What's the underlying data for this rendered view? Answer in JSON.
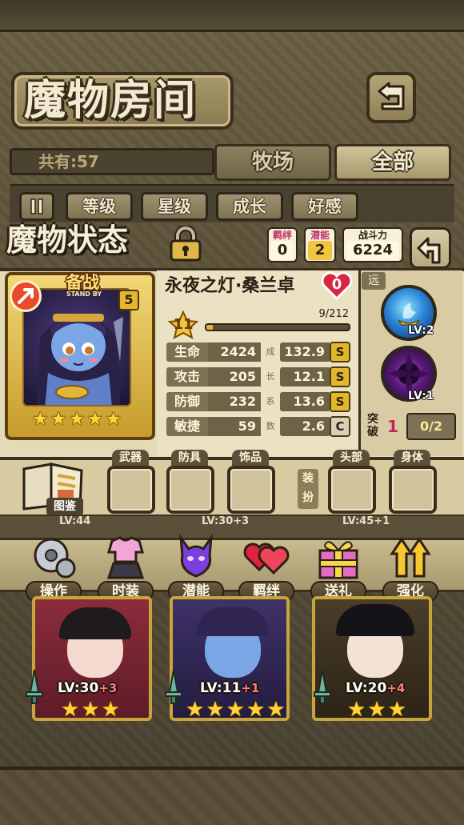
{
  "header": {
    "title": "魔物房间"
  },
  "filter": {
    "count_label": "共有:57",
    "tabs": [
      {
        "label": "牧场"
      },
      {
        "label": "全部"
      }
    ],
    "sort_buttons": [
      {
        "label": "等级"
      },
      {
        "label": "星级"
      },
      {
        "label": "成长"
      },
      {
        "label": "好感"
      }
    ]
  },
  "status": {
    "title": "魔物状态",
    "badges": {
      "bond": {
        "label": "羁绊",
        "value": "0"
      },
      "potential": {
        "label": "潜能",
        "value": "2"
      },
      "power": {
        "label": "战斗力",
        "value": "6224"
      }
    }
  },
  "monster": {
    "standby_label": "备战",
    "standby_sub": "STAND BY",
    "rank": "5",
    "stars": 5,
    "name": "永夜之灯·桑兰卓",
    "affection": "0",
    "level": "11",
    "exp_text": "9/212",
    "exp_fraction": 0.0425,
    "stats": [
      {
        "label": "生命",
        "value": "2424",
        "growth_char": "成",
        "growth": "132.9",
        "grade": "S"
      },
      {
        "label": "攻击",
        "value": "205",
        "growth_char": "长",
        "growth": "12.1",
        "grade": "S"
      },
      {
        "label": "防御",
        "value": "232",
        "growth_char": "系",
        "growth": "13.6",
        "grade": "S"
      },
      {
        "label": "敏捷",
        "value": "59",
        "growth_char": "数",
        "growth": "2.6",
        "grade": "C"
      }
    ],
    "attack_type": "远",
    "skills": [
      {
        "lv": "LV:2"
      },
      {
        "lv": "LV:1"
      }
    ],
    "breakthrough": {
      "label": "突破",
      "count": "1",
      "progress": "0/2"
    }
  },
  "equipment": {
    "book_label": "图鉴",
    "slots": [
      {
        "label": "武器"
      },
      {
        "label": "防具"
      },
      {
        "label": "饰品"
      }
    ],
    "dress_label": "装扮",
    "dress_slots": [
      {
        "label": "头部"
      },
      {
        "label": "身体"
      }
    ]
  },
  "actions": [
    {
      "label": "操作",
      "icon": "gear-icon"
    },
    {
      "label": "时装",
      "icon": "outfit-icon"
    },
    {
      "label": "潜能",
      "icon": "demon-icon"
    },
    {
      "label": "羁绊",
      "icon": "hearts-icon"
    },
    {
      "label": "送礼",
      "icon": "gift-icon"
    },
    {
      "label": "强化",
      "icon": "upgrade-arrows-icon"
    }
  ],
  "peek_row": [
    {
      "lv": "LV:44"
    },
    {
      "lv": "LV:30+3"
    },
    {
      "lv": "LV:45+1"
    }
  ],
  "monster_cards": [
    {
      "lv": "LV:30",
      "plus": "+3",
      "stars": 3
    },
    {
      "lv": "LV:11",
      "plus": "+1",
      "stars": 5
    },
    {
      "lv": "LV:20",
      "plus": "+4",
      "stars": 3
    }
  ],
  "colors": {
    "accent_gold": "#e3b534",
    "grade_s": "#e2b62e",
    "bond_pink": "#c0306e",
    "heart_red": "#d7263d"
  }
}
